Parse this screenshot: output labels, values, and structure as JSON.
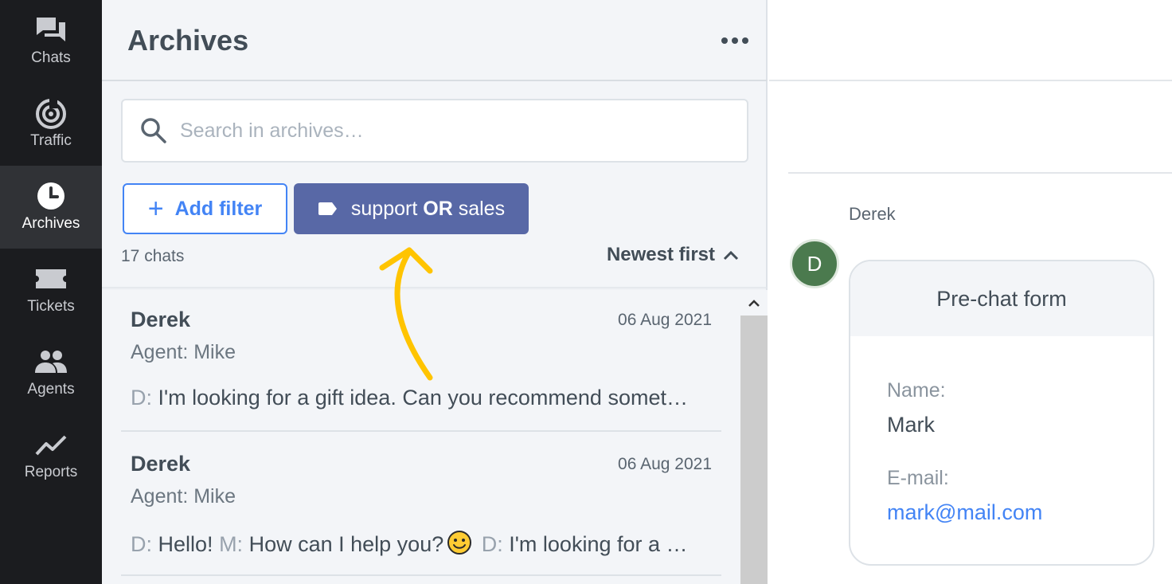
{
  "sidebar": {
    "items": [
      {
        "label": "Chats",
        "icon": "chats-icon"
      },
      {
        "label": "Traffic",
        "icon": "traffic-icon"
      },
      {
        "label": "Archives",
        "icon": "clock-icon",
        "active": true
      },
      {
        "label": "Tickets",
        "icon": "ticket-icon"
      },
      {
        "label": "Agents",
        "icon": "agents-icon"
      },
      {
        "label": "Reports",
        "icon": "reports-icon"
      }
    ]
  },
  "list": {
    "title": "Archives",
    "search_placeholder": "Search in archives…",
    "add_filter_label": "Add filter",
    "tag_filter": {
      "left": "support",
      "op": "OR",
      "right": "sales"
    },
    "chat_count": "17 chats",
    "sort_label": "Newest first",
    "chats": [
      {
        "name": "Derek",
        "date": "06 Aug 2021",
        "agent": "Agent: Mike",
        "p1_prefix": "D:",
        "p1_text": "I'm looking for a gift idea. Can you recommend somet…"
      },
      {
        "name": "Derek",
        "date": "06 Aug 2021",
        "agent": "Agent: Mike",
        "p1_prefix": "D:",
        "p1_text": "Hello!",
        "p2_prefix": "M:",
        "p2_text": "How can I help you?",
        "p3_prefix": "D:",
        "p3_text": "I'm looking for a …"
      }
    ]
  },
  "details": {
    "sender": "Derek",
    "avatar_letter": "D",
    "form": {
      "title": "Pre-chat form",
      "name_label": "Name:",
      "name_value": "Mark",
      "email_label": "E-mail:",
      "email_value": "mark@mail.com"
    }
  },
  "colors": {
    "accent": "#4384f5",
    "tag_bg": "#5868a6",
    "sidebar_bg": "#1b1c1f",
    "annotation": "#ffc400",
    "avatar": "#4b7a4e"
  }
}
